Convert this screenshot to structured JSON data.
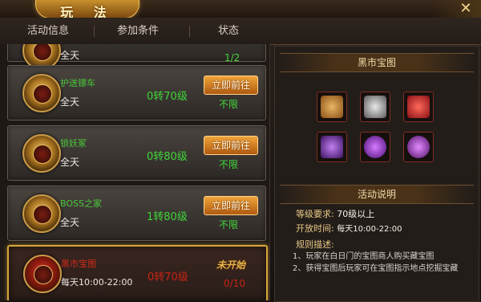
{
  "window": {
    "title": "玩 法",
    "close_icon": "close-icon"
  },
  "tabs": [
    {
      "label": "活动信息"
    },
    {
      "label": "参加条件"
    },
    {
      "label": "状态"
    }
  ],
  "activities": {
    "partial": {
      "time": "全天",
      "count": "1/2"
    },
    "items": [
      {
        "name": "护送镖车",
        "time": "全天",
        "level": "0转70级",
        "button": "立即前往",
        "limit": "不限",
        "icon": "shield-emblem-icon"
      },
      {
        "name": "锁妖冢",
        "time": "全天",
        "level": "0转80级",
        "button": "立即前往",
        "limit": "不限",
        "icon": "demon-mask-icon"
      },
      {
        "name": "BOSS之家",
        "time": "全天",
        "level": "1转80级",
        "button": "立即前往",
        "limit": "不限",
        "icon": "horned-helm-icon"
      },
      {
        "name": "黑市宝图",
        "time": "每天10:00-22:00",
        "level": "0转70级",
        "button": "未开始",
        "limit": "0/10",
        "icon": "flag-emblem-icon"
      }
    ]
  },
  "detail": {
    "title": "黑市宝图",
    "rewards": [
      {
        "icon": "treasure-map-icon",
        "color": "#c98a3a"
      },
      {
        "icon": "feather-icon",
        "color": "#9a9a9a"
      },
      {
        "icon": "red-gem-icon",
        "color": "#c8282a"
      },
      {
        "icon": "purple-claw-icon",
        "color": "#7e3ab8"
      },
      {
        "icon": "purple-orb-icon",
        "color": "#8a2cc8"
      },
      {
        "icon": "purple-swirl-icon",
        "color": "#8d2ab3"
      }
    ],
    "section_title": "活动说明",
    "level_req_label": "等级要求:",
    "level_req_value": "70级以上",
    "open_time_label": "开放时间:",
    "open_time_value": "每天10:00-22:00",
    "rules_label": "规则描述:",
    "rules": [
      "1、玩家在白日门的宝图商人购买藏宝图",
      "2、获得宝图后玩家可在宝图指示地点挖掘宝藏"
    ]
  }
}
